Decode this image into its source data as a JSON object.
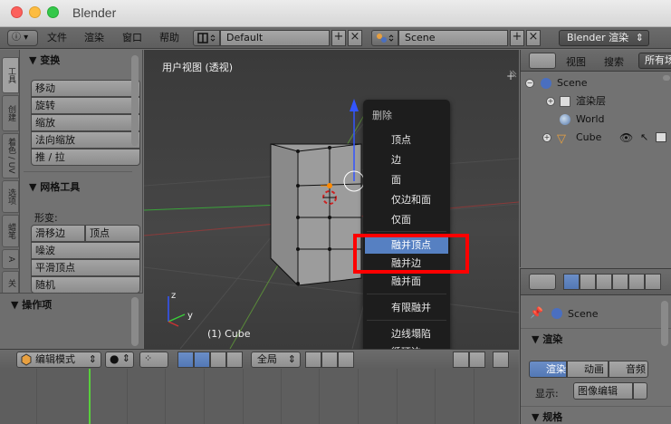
{
  "window": {
    "title": "Blender"
  },
  "top_menu": {
    "items": [
      "文件",
      "渲染",
      "窗口",
      "帮助"
    ],
    "layout_value": "Default",
    "scene_value": "Scene",
    "renderer_value": "Blender 渲染"
  },
  "tool_tabs": [
    "工具",
    "创建",
    "着色 / UV",
    "选项",
    "蜡笔",
    "A",
    "关"
  ],
  "tool_shelf": {
    "transform_title": "变换",
    "transform_buttons": [
      "移动",
      "旋转",
      "缩放",
      "法向缩放",
      "推 / 拉"
    ],
    "mesh_title": "网格工具",
    "deform_label": "形变:",
    "deform_buttons": [
      "滑移边",
      "顶点",
      "噪波",
      "平滑顶点",
      "随机"
    ],
    "operator_title": "操作项"
  },
  "viewport": {
    "title": "用户视图 (透视)",
    "object_label": "(1) Cube"
  },
  "context_menu": {
    "title": "删除",
    "items": [
      "顶点",
      "边",
      "面",
      "仅边和面",
      "仅面",
      "融并顶点",
      "融并边",
      "融并面",
      "有限融并",
      "边线塌陷",
      "循环边"
    ],
    "highlighted": "融并顶点"
  },
  "viewport_header": {
    "mode": "编辑模式",
    "pivot": "全局"
  },
  "outliner": {
    "tabs": [
      "视图",
      "搜索",
      "所有场"
    ],
    "tree": [
      "Scene",
      "渲染层",
      "World",
      "Cube"
    ]
  },
  "properties": {
    "context": "Scene",
    "render_title": "渲染",
    "render_buttons": [
      "渲染",
      "动画",
      "音频"
    ],
    "display_label": "显示:",
    "display_value": "图像编辑",
    "dimensions_title": "规格"
  },
  "colors": {
    "highlight": "#5680c2",
    "annotation_red": "#ff0000",
    "timeline_cursor": "#58cf3c"
  }
}
